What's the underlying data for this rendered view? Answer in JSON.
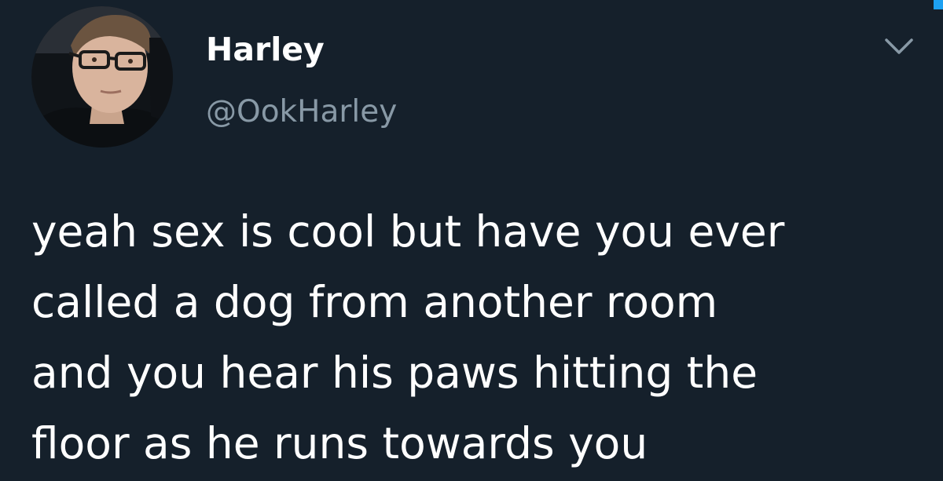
{
  "tweet": {
    "author": {
      "name": "Harley",
      "handle": "@OokHarley"
    },
    "text_lines": [
      "yeah sex is cool but have you ever",
      "called a dog from another room",
      "and you hear his paws hitting the",
      "floor as he runs towards you"
    ]
  },
  "icons": {
    "menu": "chevron-down-icon",
    "avatar": "user-avatar-photo"
  },
  "colors": {
    "background": "#15202b",
    "text": "#ffffff",
    "secondary_text": "#8899a6",
    "accent": "#1da1f2"
  }
}
